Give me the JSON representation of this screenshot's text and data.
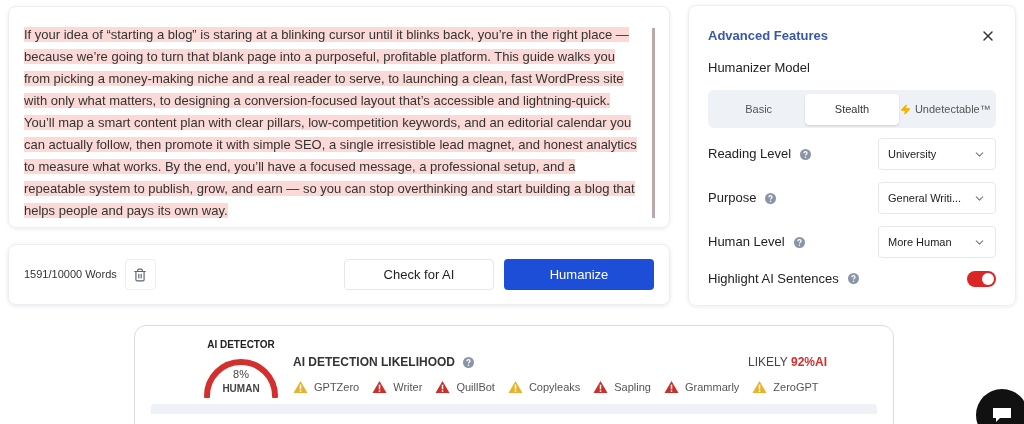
{
  "editor": {
    "sentences": [
      {
        "text": "If your idea of “starting a blog” is staring at a blinking cursor until it blinks back, you’re in the right place — because we’re going to turn that blank page into a purposeful, profitable platform.",
        "highlighted": true
      },
      {
        "text": "This guide walks you from picking a money-making niche and a real reader to serve, to launching a clean, fast WordPress site with only what matters, to designing a conversion-focused layout that’s accessible and lightning-quick.",
        "highlighted": true
      },
      {
        "text": "You’ll map a smart content plan with clear pillars, low-competition keywords, and an editorial calendar you can actually follow, then promote it with simple SEO, a single irresistible lead magnet, and honest analytics to measure what works.",
        "highlighted": true
      },
      {
        "text": "By the end, you’ll have a focused message, a professional setup, and a repeatable system to publish, grow, and earn — so you can stop overthinking and start building a blog that helps people and pays its own way.",
        "highlighted": true
      }
    ]
  },
  "footer": {
    "word_count": "1591/10000 Words",
    "check_button": "Check for AI",
    "humanize_button": "Humanize"
  },
  "advanced": {
    "title": "Advanced Features",
    "model_label": "Humanizer Model",
    "models": [
      {
        "label": "Basic",
        "selected": false,
        "premium": false
      },
      {
        "label": "Stealth",
        "selected": true,
        "premium": false
      },
      {
        "label": "Undetectable™",
        "selected": false,
        "premium": true
      }
    ],
    "settings": [
      {
        "label": "Reading Level",
        "value": "University"
      },
      {
        "label": "Purpose",
        "value": "General Writi..."
      },
      {
        "label": "Human Level",
        "value": "More Human"
      }
    ],
    "highlight": {
      "label": "Highlight AI Sentences",
      "on": true
    }
  },
  "detector": {
    "title": "AI DETECTOR",
    "gauge_value": "8%",
    "gauge_label": "HUMAN",
    "likelihood_title": "AI DETECTION LIKELIHOOD",
    "verdict_prefix": "LIKELY",
    "verdict_value": "92%AI",
    "checkers": [
      {
        "name": "GPTZero",
        "color": "#e8b32c"
      },
      {
        "name": "Writer",
        "color": "#c9302c"
      },
      {
        "name": "QuillBot",
        "color": "#c9302c"
      },
      {
        "name": "Copyleaks",
        "color": "#e8b32c"
      },
      {
        "name": "Sapling",
        "color": "#c9302c"
      },
      {
        "name": "Grammarly",
        "color": "#c9302c"
      },
      {
        "name": "ZeroGPT",
        "color": "#e8b32c"
      }
    ]
  }
}
